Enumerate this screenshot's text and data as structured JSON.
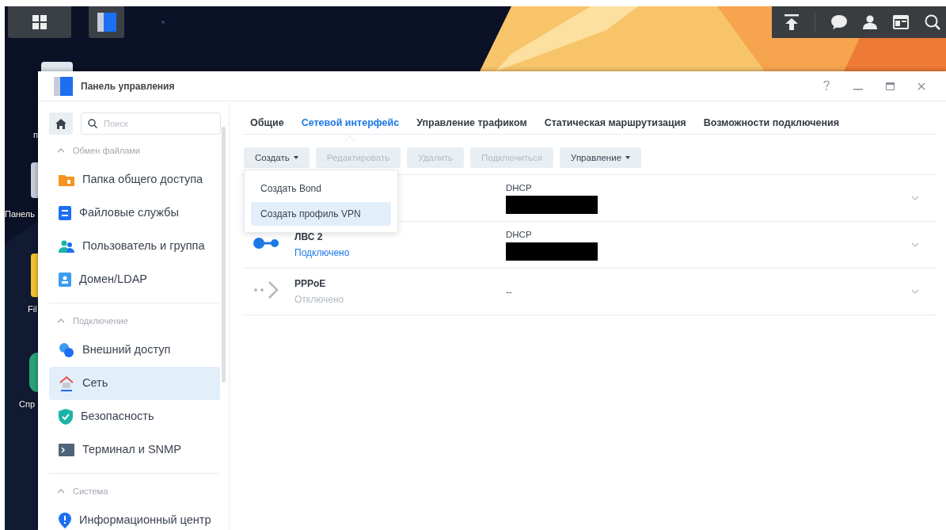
{
  "desktop_icons": [
    {
      "label": "п"
    },
    {
      "label": "Панель"
    },
    {
      "label": "Fil"
    },
    {
      "label": "Спр"
    }
  ],
  "window": {
    "title": "Панель управления"
  },
  "search": {
    "placeholder": "Поиск"
  },
  "sidebar": {
    "sections": [
      {
        "title": "Обмен файлами",
        "expanded": true,
        "items": [
          {
            "label": "Папка общего доступа",
            "selected": false
          },
          {
            "label": "Файловые службы",
            "selected": false
          },
          {
            "label": "Пользователь и группа",
            "selected": false
          },
          {
            "label": "Домен/LDAP",
            "selected": false
          }
        ]
      },
      {
        "title": "Подключение",
        "expanded": true,
        "items": [
          {
            "label": "Внешний доступ",
            "selected": false
          },
          {
            "label": "Сеть",
            "selected": true
          },
          {
            "label": "Безопасность",
            "selected": false
          },
          {
            "label": "Терминал и SNMP",
            "selected": false
          }
        ]
      },
      {
        "title": "Система",
        "expanded": true,
        "items": [
          {
            "label": "Информационный центр",
            "selected": false
          }
        ]
      }
    ]
  },
  "tabs": [
    {
      "label": "Общие",
      "selected": false
    },
    {
      "label": "Сетевой интерфейс",
      "selected": true
    },
    {
      "label": "Управление трафиком",
      "selected": false
    },
    {
      "label": "Статическая маршрутизация",
      "selected": false
    },
    {
      "label": "Возможности подключения",
      "selected": false
    }
  ],
  "toolbar": [
    {
      "label": "Создать",
      "kind": "dropdown",
      "disabled": false
    },
    {
      "label": "Редактировать",
      "kind": "button",
      "disabled": true
    },
    {
      "label": "Удалить",
      "kind": "button",
      "disabled": true
    },
    {
      "label": "Подключиться",
      "kind": "button",
      "disabled": true
    },
    {
      "label": "Управление",
      "kind": "dropdown",
      "disabled": false
    }
  ],
  "create_menu": [
    {
      "label": "Создать Bond",
      "selected": false
    },
    {
      "label": "Создать профиль VPN",
      "selected": true
    }
  ],
  "interfaces": [
    {
      "config": "DHCP",
      "address_redacted": true
    },
    {
      "kind": "lan",
      "name": "ЛВС 2",
      "status": "Подключено",
      "connected": true,
      "config": "DHCP",
      "address_redacted": true
    },
    {
      "kind": "pppoe",
      "name": "PPPoE",
      "status": "Отключено",
      "connected": false,
      "config": "--",
      "address_redacted": false
    }
  ]
}
